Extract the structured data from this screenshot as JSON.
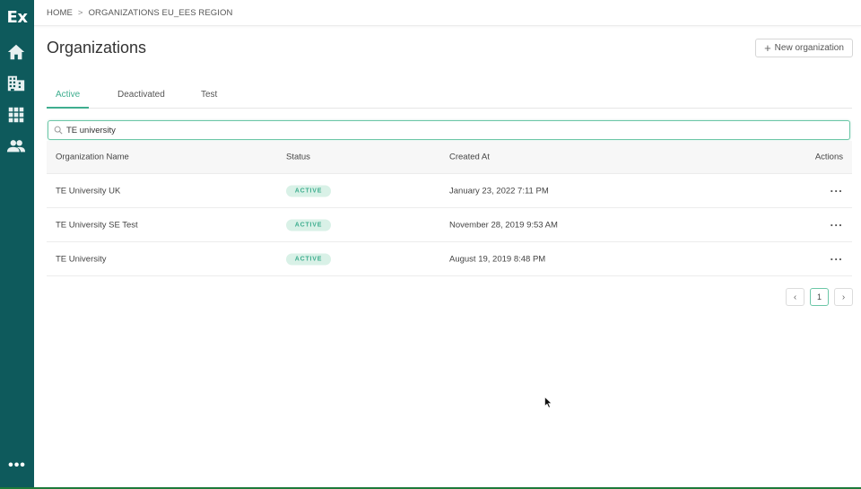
{
  "sidebar": {
    "logo": "Ex",
    "items": [
      {
        "icon": "home-icon"
      },
      {
        "icon": "building-icon"
      },
      {
        "icon": "apps-grid-icon"
      },
      {
        "icon": "people-icon"
      }
    ],
    "more": "•••"
  },
  "breadcrumb": {
    "home": "HOME",
    "separator": ">",
    "current": "ORGANIZATIONS EU_EES REGION"
  },
  "page": {
    "title": "Organizations",
    "new_button_label": "New organization",
    "new_button_icon": "+"
  },
  "tabs": [
    {
      "label": "Active",
      "active": true
    },
    {
      "label": "Deactivated",
      "active": false
    },
    {
      "label": "Test",
      "active": false
    }
  ],
  "search": {
    "value": "TE university",
    "placeholder": ""
  },
  "table": {
    "headers": {
      "name": "Organization Name",
      "status": "Status",
      "created": "Created At",
      "actions": "Actions"
    },
    "rows": [
      {
        "name": "TE University UK",
        "status": "ACTIVE",
        "created": "January 23, 2022 7:11 PM",
        "actions": "···"
      },
      {
        "name": "TE University SE Test",
        "status": "ACTIVE",
        "created": "November 28, 2019 9:53 AM",
        "actions": "···"
      },
      {
        "name": "TE University",
        "status": "ACTIVE",
        "created": "August 19, 2019 8:48 PM",
        "actions": "···"
      }
    ]
  },
  "pagination": {
    "prev": "‹",
    "current": "1",
    "next": "›"
  },
  "colors": {
    "sidebar": "#0e5a5c",
    "accent": "#3fae8f",
    "badge_bg": "#d9f1e7"
  }
}
